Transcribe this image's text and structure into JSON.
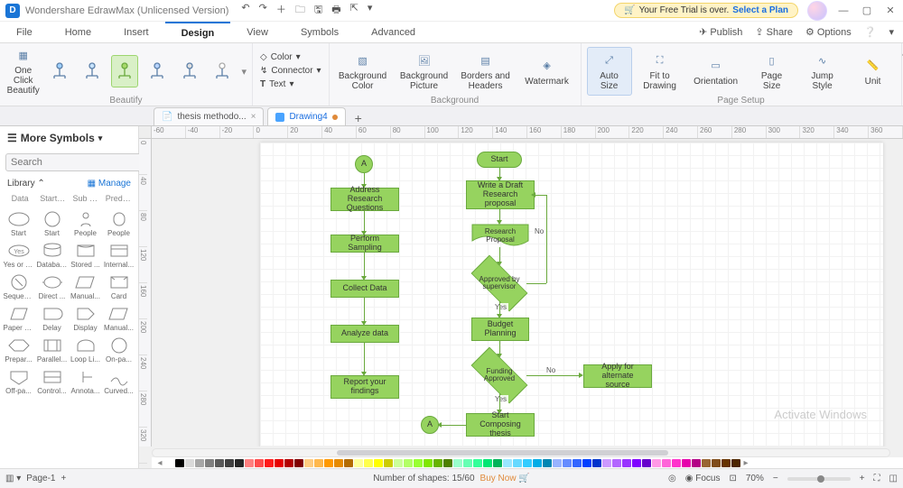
{
  "title": "Wondershare EdrawMax (Unlicensed Version)",
  "trial": {
    "prefix": "Your Free Trial is over. ",
    "action": "Select a Plan"
  },
  "menu": {
    "items": [
      "File",
      "Home",
      "Insert",
      "Design",
      "View",
      "Symbols",
      "Advanced"
    ],
    "active": "Design",
    "right": {
      "publish": "Publish",
      "share": "Share",
      "options": "Options"
    }
  },
  "ribbon": {
    "oneclick": "One Click\nBeautify",
    "beautify_label": "Beautify",
    "color": "Color",
    "connector": "Connector",
    "text": "Text",
    "bgcolor": "Background\nColor",
    "bgpic": "Background\nPicture",
    "borders": "Borders and\nHeaders",
    "watermark": "Watermark",
    "bg_label": "Background",
    "autosize": "Auto\nSize",
    "fit": "Fit to\nDrawing",
    "orientation": "Orientation",
    "pagesize": "Page\nSize",
    "jump": "Jump\nStyle",
    "unit": "Unit",
    "pagesetup_label": "Page Setup"
  },
  "tabs": {
    "t1": "thesis methodo...",
    "t2": "Drawing4"
  },
  "side": {
    "title": "More Symbols",
    "search_ph": "Search",
    "search_btn": "Search",
    "library": "Library",
    "manage": "Manage",
    "cats": [
      "Data",
      "Start or...",
      "Sub Pro...",
      "Predefi..."
    ],
    "shapes": [
      [
        "Start",
        "Start",
        "People",
        "People"
      ],
      [
        "Yes or No",
        "Database",
        "Stored ...",
        "Internal..."
      ],
      [
        "Sequen...",
        "Direct ...",
        "Manual...",
        "Card"
      ],
      [
        "Paper T...",
        "Delay",
        "Display",
        "Manual..."
      ],
      [
        "Prepar...",
        "Parallel...",
        "Loop Li...",
        "On-pa..."
      ],
      [
        "Off-pa...",
        "Control...",
        "Annota...",
        "Curved..."
      ]
    ]
  },
  "ruler_h": [
    "-60",
    "-40",
    "-20",
    "0",
    "20",
    "40",
    "60",
    "80",
    "100",
    "120",
    "140",
    "160",
    "180",
    "200",
    "220",
    "240",
    "260",
    "280",
    "300",
    "320",
    "340",
    "360"
  ],
  "ruler_v": [
    "0",
    "40",
    "80",
    "120",
    "160",
    "200",
    "240",
    "280",
    "320"
  ],
  "flow": {
    "left": {
      "a": "A",
      "n1": "Address Research\nQuestions",
      "n2": "Perform Sampling",
      "n3": "Collect Data",
      "n4": "Analyze data",
      "n5": "Report your\nfindings"
    },
    "right": {
      "start": "Start",
      "n1": "Write a Draft\nResearch\nproposal",
      "n2": "Research\nProposal",
      "d1": "Approved by\nsupervisor",
      "no1": "No",
      "yes1": "Yes",
      "n3": "Budget\nPlanning",
      "d2": "Funding\nApproved",
      "no2": "No",
      "yes2": "Yes",
      "alt": "Apply for alternate\nsource",
      "n4": "Start Composing\nthesis",
      "a": "A"
    }
  },
  "status": {
    "page": "Page-1",
    "shapes_label": "Number of shapes:",
    "shapes": "15/60",
    "buy": "Buy Now",
    "focus": "Focus",
    "zoom": "70%"
  },
  "watermark_msg": "Activate Windows",
  "palette": [
    "#ffffff",
    "#000000",
    "#d9d9d9",
    "#a6a6a6",
    "#7f7f7f",
    "#595959",
    "#404040",
    "#262626",
    "#ff8080",
    "#ff4d4d",
    "#ff1a1a",
    "#e60000",
    "#b30000",
    "#800000",
    "#ffcc80",
    "#ffb84d",
    "#ff9900",
    "#e68a00",
    "#b36b00",
    "#ffff99",
    "#ffff4d",
    "#ffff00",
    "#cccc00",
    "#ccff99",
    "#b3ff66",
    "#99ff33",
    "#80e600",
    "#66b300",
    "#4d8000",
    "#99ffcc",
    "#66ffb3",
    "#33ff99",
    "#00e673",
    "#00b359",
    "#99e6ff",
    "#66d9ff",
    "#33ccff",
    "#00ace6",
    "#0086b3",
    "#99b3ff",
    "#668cff",
    "#3366ff",
    "#0040ff",
    "#0033cc",
    "#cc99ff",
    "#b366ff",
    "#9933ff",
    "#7f00ff",
    "#6600cc",
    "#ff99e6",
    "#ff66d9",
    "#ff33cc",
    "#e600ac",
    "#b30086",
    "#996633",
    "#804d1a",
    "#663300",
    "#4d2600"
  ]
}
